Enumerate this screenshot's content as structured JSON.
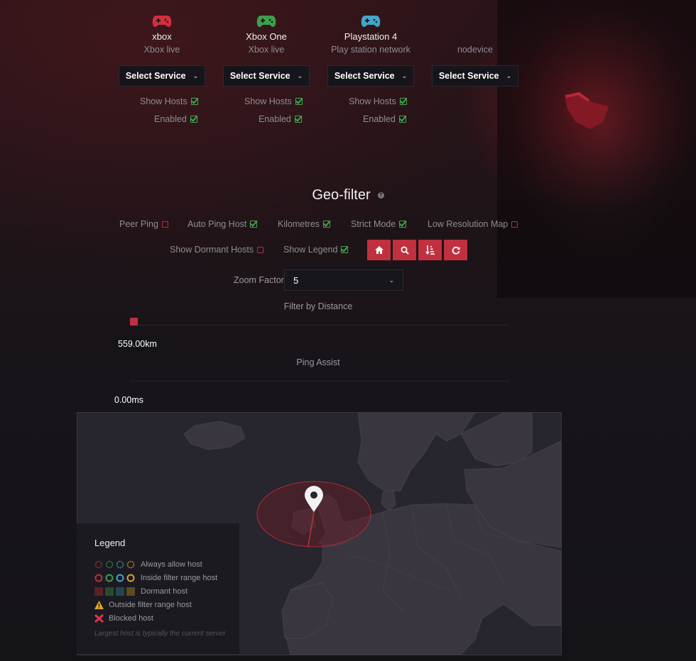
{
  "devices": [
    {
      "name": "xbox",
      "network": "Xbox live",
      "color": "#d0303e"
    },
    {
      "name": "Xbox One",
      "network": "Xbox live",
      "color": "#3aa04a"
    },
    {
      "name": "Playstation 4",
      "network": "Play station network",
      "color": "#3fa7c9"
    },
    {
      "name": "",
      "network": "nodevice",
      "color": ""
    }
  ],
  "service_select_label": "Select Service",
  "show_hosts_label": "Show Hosts",
  "enabled_label": "Enabled",
  "geo": {
    "title": "Geo-filter",
    "options_row1": [
      {
        "label": "Peer Ping",
        "checked": false
      },
      {
        "label": "Auto Ping Host",
        "checked": true
      },
      {
        "label": "Kilometres",
        "checked": true
      },
      {
        "label": "Strict Mode",
        "checked": true
      },
      {
        "label": "Low Resolution Map",
        "checked": false
      }
    ],
    "options_row2": [
      {
        "label": "Show Dormant Hosts",
        "checked": false
      },
      {
        "label": "Show Legend",
        "checked": true
      }
    ],
    "buttons": [
      {
        "name": "home",
        "icon": "home-icon"
      },
      {
        "name": "search",
        "icon": "search-icon"
      },
      {
        "name": "sort",
        "icon": "sort-amount-icon"
      },
      {
        "name": "refresh",
        "icon": "refresh-icon"
      }
    ],
    "zoom_label": "Zoom Factor",
    "zoom_value": "5",
    "distance_label": "Filter by Distance",
    "distance_value": "559.00km",
    "distance_fraction": 0.0,
    "ping_label": "Ping Assist",
    "ping_value": "0.00ms"
  },
  "legend": {
    "title": "Legend",
    "items": [
      {
        "label": "Always allow host",
        "symbol": "dotted-rings"
      },
      {
        "label": "Inside filter range host",
        "symbol": "rings"
      },
      {
        "label": "Dormant host",
        "symbol": "squares"
      },
      {
        "label": "Outside filter range host",
        "symbol": "warning-icon"
      },
      {
        "label": "Blocked host",
        "symbol": "cross-icon"
      }
    ],
    "note": "Largest host is typically the current server"
  },
  "colors": {
    "accent": "#c0303f",
    "check": "#3fa84a",
    "ps": "#3fa7c9",
    "xboxone": "#3aa04a"
  }
}
